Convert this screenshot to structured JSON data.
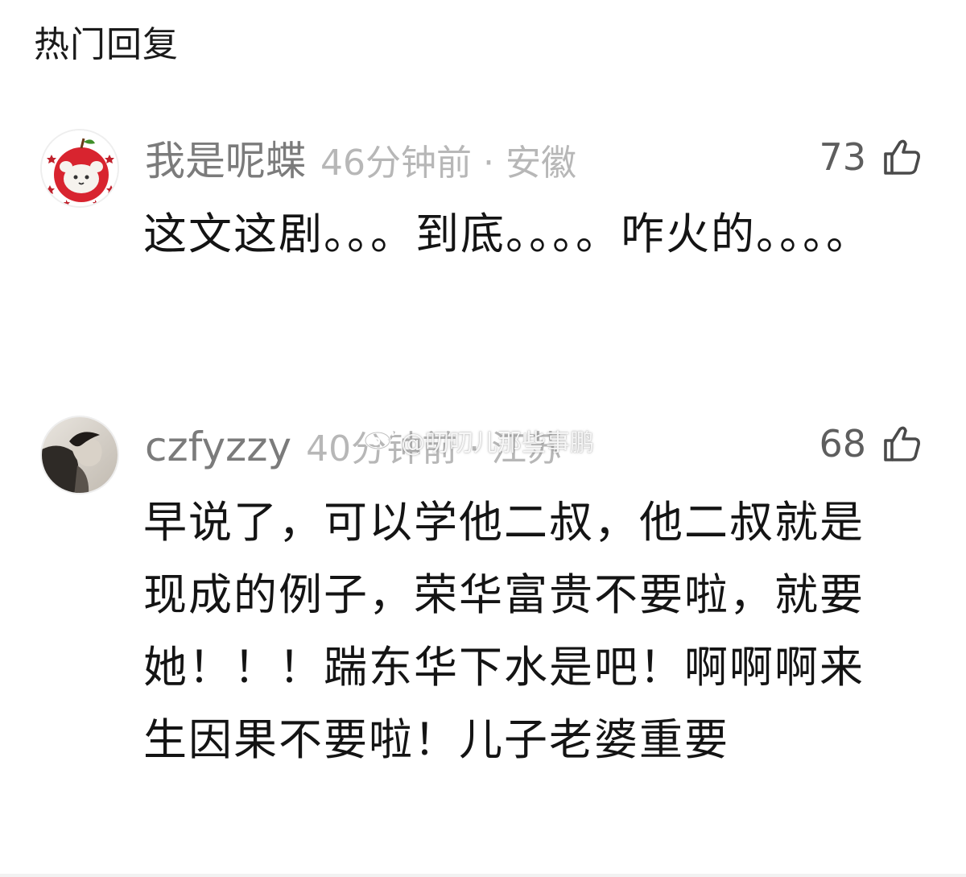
{
  "section": {
    "title": "热门回复"
  },
  "comments": [
    {
      "username": "我是呢蝶",
      "time_location": "46分钟前 · 安徽",
      "likes": "73",
      "text": "这文这剧。。。到底。。。。咋火的。。。。",
      "avatar_icon": "apple-bear-avatar"
    },
    {
      "username": "czfyzzy",
      "time_location": "40分钟前 · 江苏",
      "likes": "68",
      "text": "早说了，可以学他二叔，他二叔就是现成的例子，荣华富贵不要啦，就要她！！！踹东华下水是吧！啊啊啊来生因果不要啦！儿子老婆重要",
      "avatar_icon": "bw-portrait-avatar"
    }
  ],
  "watermark": {
    "text": "@叨叨儿那些事鹏"
  },
  "icons": {
    "like": "thumbs-up-icon",
    "weibo": "weibo-logo-icon"
  },
  "colors": {
    "username": "#7b7b7b",
    "meta": "#b7b7b7",
    "body": "#141414"
  }
}
